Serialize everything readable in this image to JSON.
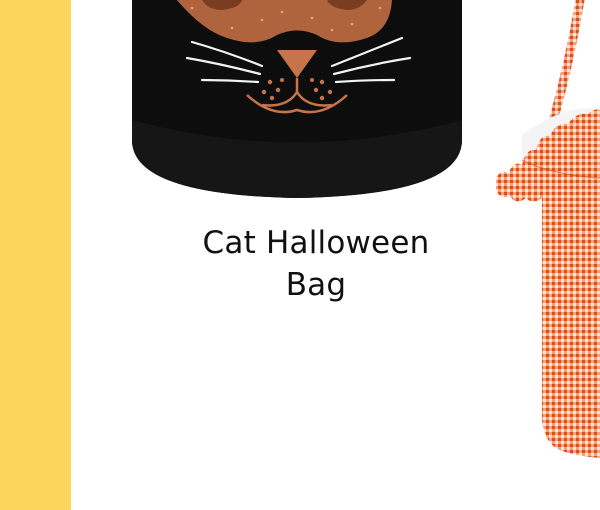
{
  "colors": {
    "accent_band": "#FDD55E",
    "bag_black": "#0d0d0d",
    "mask_copper": "#b0643e",
    "gingham_orange": "#e8663a",
    "page_background": "#ffffff"
  },
  "carousel": {
    "current_card": {
      "title_line_1": "Cat Halloween",
      "title_line_2": "Bag",
      "image_icon": "cat-face-bag-image"
    },
    "next_card": {
      "image_icon": "gingham-bucket-image"
    }
  }
}
